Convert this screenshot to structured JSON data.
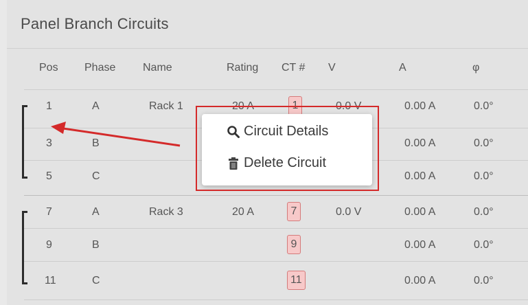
{
  "panel": {
    "title": "Panel Branch Circuits"
  },
  "columns": {
    "pos": "Pos",
    "phase": "Phase",
    "name": "Name",
    "rating": "Rating",
    "ct": "CT #",
    "v": "V",
    "a": "A",
    "phi": "φ"
  },
  "rows": [
    {
      "pos": "1",
      "phase": "A",
      "name": "Rack 1",
      "rating": "20 A",
      "ct": "1",
      "v": "0.0 V",
      "a": "0.00 A",
      "phi": "0.0°"
    },
    {
      "pos": "3",
      "phase": "B",
      "name": "",
      "rating": "",
      "ct": "",
      "v": "",
      "a": "0.00 A",
      "phi": "0.0°"
    },
    {
      "pos": "5",
      "phase": "C",
      "name": "",
      "rating": "",
      "ct": "",
      "v": "",
      "a": "0.00 A",
      "phi": "0.0°"
    },
    {
      "pos": "7",
      "phase": "A",
      "name": "Rack 3",
      "rating": "20 A",
      "ct": "7",
      "v": "0.0 V",
      "a": "0.00 A",
      "phi": "0.0°"
    },
    {
      "pos": "9",
      "phase": "B",
      "name": "",
      "rating": "",
      "ct": "9",
      "v": "",
      "a": "0.00 A",
      "phi": "0.0°"
    },
    {
      "pos": "11",
      "phase": "C",
      "name": "",
      "rating": "",
      "ct": "11",
      "v": "",
      "a": "0.00 A",
      "phi": "0.0°"
    }
  ],
  "context_menu": {
    "details_label": "Circuit Details",
    "delete_label": "Delete Circuit",
    "details_icon": "search-icon",
    "delete_icon": "trash-icon"
  },
  "colors": {
    "annotation_red": "#d42a2a",
    "ct_box_fill": "#f7c9c9",
    "ct_box_border": "#d47a7a",
    "bracket": "#2c2c2c"
  }
}
